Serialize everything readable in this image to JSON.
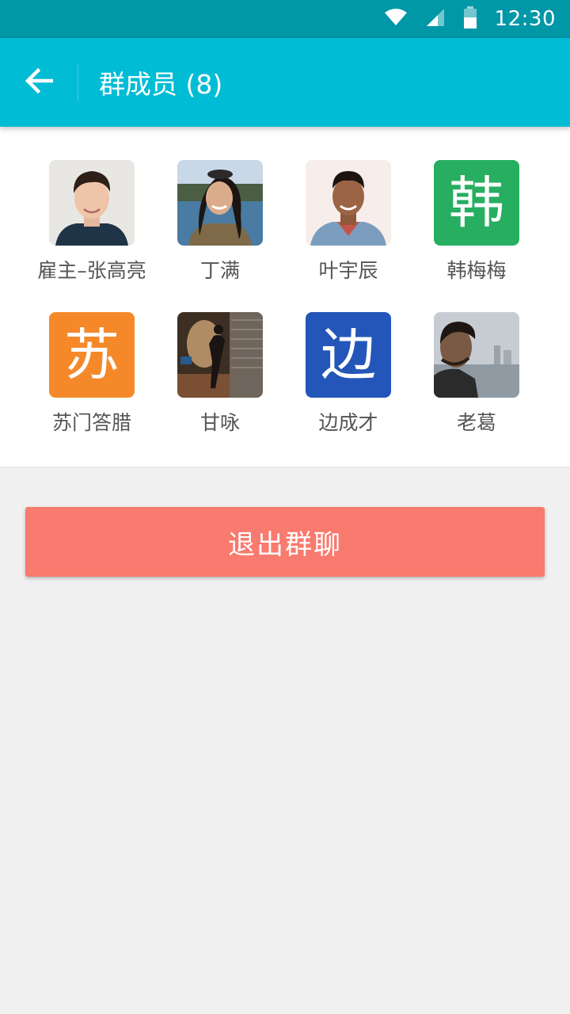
{
  "status_bar": {
    "time": "12:30",
    "icons": [
      "wifi-icon",
      "signal-icon",
      "battery-icon"
    ]
  },
  "app_bar": {
    "back_icon": "arrow-left-icon",
    "title": "群成员 (8)"
  },
  "members": [
    {
      "name": "雇主–张高亮",
      "avatar_type": "photo"
    },
    {
      "name": "丁满",
      "avatar_type": "photo"
    },
    {
      "name": "叶宇辰",
      "avatar_type": "photo"
    },
    {
      "name": "韩梅梅",
      "avatar_type": "letter",
      "letter": "韩",
      "color": "#27ae60"
    },
    {
      "name": "苏门答腊",
      "avatar_type": "letter",
      "letter": "苏",
      "color": "#f5892a"
    },
    {
      "name": "甘咏",
      "avatar_type": "photo"
    },
    {
      "name": "边成才",
      "avatar_type": "letter",
      "letter": "边",
      "color": "#2356b8"
    },
    {
      "name": "老葛",
      "avatar_type": "photo"
    }
  ],
  "quit_button": {
    "label": "退出群聊",
    "color": "#f97a6e"
  },
  "colors": {
    "status_bar": "#0097a7",
    "app_bar": "#00bcd4",
    "background": "#f0f0f0"
  }
}
